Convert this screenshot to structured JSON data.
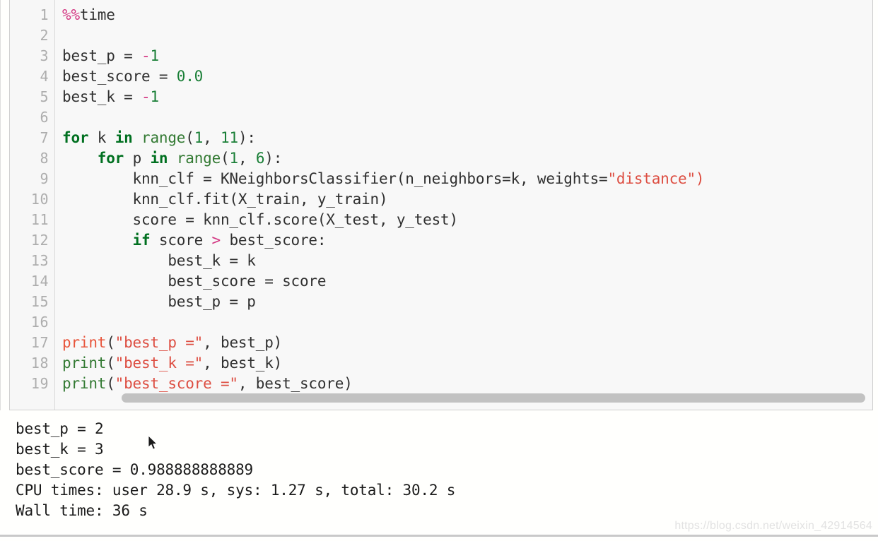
{
  "notebook": {
    "cell": {
      "line_numbers": [
        "1",
        "2",
        "3",
        "4",
        "5",
        "6",
        "7",
        "8",
        "9",
        "10",
        "11",
        "12",
        "13",
        "14",
        "15",
        "16",
        "17",
        "18",
        "19"
      ],
      "code_lines": [
        {
          "n": "1",
          "tokens": [
            {
              "t": "%%",
              "c": "magic"
            },
            {
              "t": "time",
              "c": "plain"
            }
          ]
        },
        {
          "n": "2",
          "tokens": []
        },
        {
          "n": "3",
          "tokens": [
            {
              "t": "best_p ",
              "c": "plain"
            },
            {
              "t": "=",
              "c": "plain"
            },
            {
              "t": " ",
              "c": "plain"
            },
            {
              "t": "-",
              "c": "op"
            },
            {
              "t": "1",
              "c": "num"
            }
          ]
        },
        {
          "n": "4",
          "tokens": [
            {
              "t": "best_score ",
              "c": "plain"
            },
            {
              "t": "=",
              "c": "plain"
            },
            {
              "t": " ",
              "c": "plain"
            },
            {
              "t": "0.0",
              "c": "num"
            }
          ]
        },
        {
          "n": "5",
          "tokens": [
            {
              "t": "best_k ",
              "c": "plain"
            },
            {
              "t": "=",
              "c": "plain"
            },
            {
              "t": " ",
              "c": "plain"
            },
            {
              "t": "-",
              "c": "op"
            },
            {
              "t": "1",
              "c": "num"
            }
          ]
        },
        {
          "n": "6",
          "tokens": []
        },
        {
          "n": "7",
          "tokens": [
            {
              "t": "for",
              "c": "kw"
            },
            {
              "t": " k ",
              "c": "plain"
            },
            {
              "t": "in",
              "c": "kw"
            },
            {
              "t": " ",
              "c": "plain"
            },
            {
              "t": "range",
              "c": "builtin"
            },
            {
              "t": "(",
              "c": "plain"
            },
            {
              "t": "1",
              "c": "num"
            },
            {
              "t": ", ",
              "c": "plain"
            },
            {
              "t": "11",
              "c": "num"
            },
            {
              "t": "):",
              "c": "plain"
            }
          ]
        },
        {
          "n": "8",
          "tokens": [
            {
              "t": "    ",
              "c": "plain"
            },
            {
              "t": "for",
              "c": "kw"
            },
            {
              "t": " p ",
              "c": "plain"
            },
            {
              "t": "in",
              "c": "kw"
            },
            {
              "t": " ",
              "c": "plain"
            },
            {
              "t": "range",
              "c": "builtin"
            },
            {
              "t": "(",
              "c": "plain"
            },
            {
              "t": "1",
              "c": "num"
            },
            {
              "t": ", ",
              "c": "plain"
            },
            {
              "t": "6",
              "c": "num"
            },
            {
              "t": "):",
              "c": "plain"
            }
          ]
        },
        {
          "n": "9",
          "tokens": [
            {
              "t": "        knn_clf = KNeighborsClassifier(n_neighbors=k, weights=",
              "c": "plain"
            },
            {
              "t": "\"distance\")",
              "c": "str"
            }
          ]
        },
        {
          "n": "10",
          "tokens": [
            {
              "t": "        knn_clf.fit(X_train, y_train)",
              "c": "plain"
            }
          ]
        },
        {
          "n": "11",
          "tokens": [
            {
              "t": "        score = knn_clf.score(X_test, y_test)",
              "c": "plain"
            }
          ]
        },
        {
          "n": "12",
          "tokens": [
            {
              "t": "        ",
              "c": "plain"
            },
            {
              "t": "if",
              "c": "kw"
            },
            {
              "t": " score ",
              "c": "plain"
            },
            {
              "t": ">",
              "c": "op"
            },
            {
              "t": " best_score:",
              "c": "plain"
            }
          ]
        },
        {
          "n": "13",
          "tokens": [
            {
              "t": "            best_k = k",
              "c": "plain"
            }
          ]
        },
        {
          "n": "14",
          "tokens": [
            {
              "t": "            best_score = score",
              "c": "plain"
            }
          ]
        },
        {
          "n": "15",
          "tokens": [
            {
              "t": "            best_p = p",
              "c": "plain"
            }
          ]
        },
        {
          "n": "16",
          "tokens": []
        },
        {
          "n": "17",
          "tokens": [
            {
              "t": "print",
              "c": "builtin-alt"
            },
            {
              "t": "(",
              "c": "plain"
            },
            {
              "t": "\"best_p =\"",
              "c": "str"
            },
            {
              "t": ", best_p)",
              "c": "plain"
            }
          ]
        },
        {
          "n": "18",
          "tokens": [
            {
              "t": "print",
              "c": "builtin"
            },
            {
              "t": "(",
              "c": "plain"
            },
            {
              "t": "\"best_k =\"",
              "c": "str"
            },
            {
              "t": ", best_k)",
              "c": "plain"
            }
          ]
        },
        {
          "n": "19",
          "tokens": [
            {
              "t": "print",
              "c": "builtin"
            },
            {
              "t": "(",
              "c": "plain"
            },
            {
              "t": "\"best_score =\"",
              "c": "str"
            },
            {
              "t": ", best_score)",
              "c": "plain"
            }
          ]
        }
      ]
    },
    "output": {
      "lines": [
        "best_p = 2",
        "best_k = 3",
        "best_score = 0.988888888889",
        "CPU times: user 28.9 s, sys: 1.27 s, total: 30.2 s",
        "Wall time: 36 s"
      ],
      "values": {
        "best_p": "2",
        "best_k": "3",
        "best_score": "0.988888888889",
        "cpu_user": "28.9 s",
        "cpu_sys": "1.27 s",
        "cpu_total": "30.2 s",
        "wall_time": "36 s"
      }
    },
    "watermark": "https://blog.csdn.net/weixin_42914564",
    "colors": {
      "cell_background": "#f8f8f8",
      "cell_border": "#cfcfcf",
      "gutter_text": "#adadad",
      "keyword": "#007020",
      "builtin": "#337a33",
      "builtin_alt": "#e8553b",
      "string": "#dd4e42",
      "number": "#1a7f37",
      "operator": "#d33682",
      "plain_text": "#303030",
      "output_text": "#1b1b1b",
      "scrollbar_thumb": "#c2c2c2",
      "watermark": "#e2e2e2"
    }
  }
}
